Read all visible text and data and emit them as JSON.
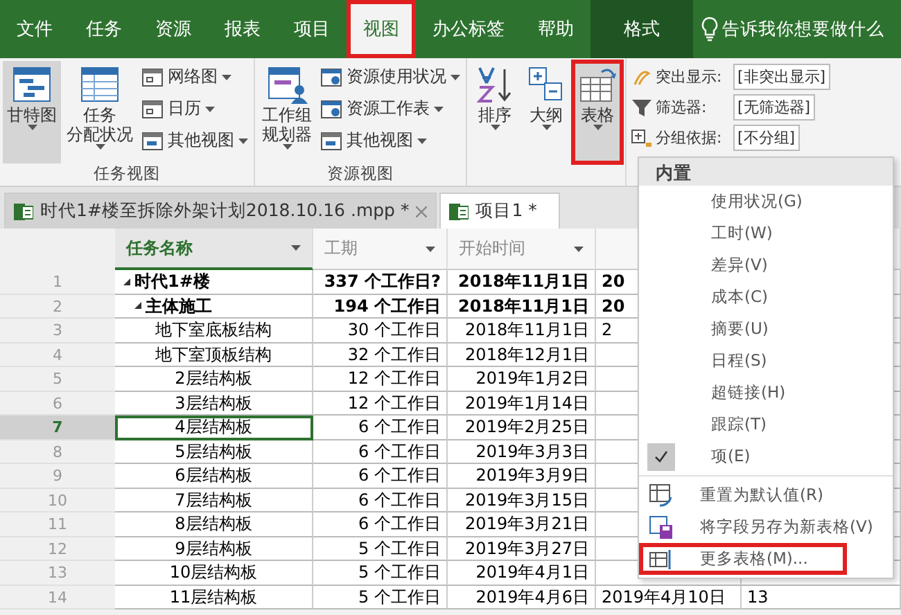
{
  "menu_tabs": [
    {
      "label": "文件",
      "selected": false,
      "highlighted": false
    },
    {
      "label": "任务",
      "selected": false,
      "highlighted": false
    },
    {
      "label": "资源",
      "selected": false,
      "highlighted": false
    },
    {
      "label": "报表",
      "selected": false,
      "highlighted": false
    },
    {
      "label": "项目",
      "selected": false,
      "highlighted": false
    },
    {
      "label": "视图",
      "selected": true,
      "highlighted": true
    },
    {
      "label": "办公标签",
      "selected": false,
      "highlighted": false
    },
    {
      "label": "帮助",
      "selected": false,
      "highlighted": false
    }
  ],
  "context_tab": {
    "label": "格式"
  },
  "tell_me": {
    "placeholder": "告诉我你想要做什么"
  },
  "ribbon": {
    "groups": [
      {
        "label": "任务视图",
        "large": [
          {
            "lines": [
              "甘特图"
            ],
            "selected": true
          },
          {
            "lines": [
              "任务",
              "分配状况"
            ],
            "selected": false
          }
        ],
        "small": [
          {
            "label": "网络图"
          },
          {
            "label": "日历"
          },
          {
            "label": "其他视图"
          }
        ]
      },
      {
        "label": "资源视图",
        "large": [
          {
            "lines": [
              "工作组",
              "规划器"
            ],
            "selected": false
          }
        ],
        "small": [
          {
            "label": "资源使用状况"
          },
          {
            "label": "资源工作表"
          },
          {
            "label": "其他视图"
          }
        ]
      },
      {
        "large": [
          {
            "lines": [
              "排序"
            ],
            "selected": false
          },
          {
            "lines": [
              "大纲"
            ],
            "selected": false
          },
          {
            "lines": [
              "表格"
            ],
            "selected": true,
            "highlighted": true
          }
        ]
      }
    ],
    "fields": [
      {
        "label": "突出显示:",
        "value": "[非突出显示]"
      },
      {
        "label": "筛选器:",
        "value": "[无筛选器]"
      },
      {
        "label": "分组依据:",
        "value": "[不分组]"
      }
    ]
  },
  "doc_tabs": [
    {
      "label": "时代1#楼至拆除外架计划2018.10.16 .mpp *",
      "selected": false,
      "closable": true
    },
    {
      "label": "项目1 *",
      "selected": true,
      "closable": false
    }
  ],
  "table": {
    "columns": [
      {
        "label": "任务名称",
        "sorted": true
      },
      {
        "label": "工期",
        "sorted": false
      },
      {
        "label": "开始时间",
        "sorted": false
      }
    ],
    "rows": [
      {
        "num": "1",
        "name": "时代1#楼",
        "duration": "337  个工作日?",
        "start": "2018年11月1日",
        "column_4": "20",
        "selected": false,
        "expanded": true,
        "children": [
          {
            "num": "2",
            "name": "主体施工",
            "duration": "194  个工作日",
            "start": "2018年11月1日",
            "column_4": "20",
            "selected": false,
            "expanded": true,
            "children": [
              {
                "num": "3",
                "name": "地下室底板结构",
                "duration": "30 个工作日",
                "start": "2018年11月1日",
                "column_4": "2",
                "selected": false
              },
              {
                "num": "4",
                "name": "地下室顶板结构",
                "duration": "32 个工作日",
                "start": "2018年12月1日",
                "selected": false
              },
              {
                "num": "5",
                "name": "2层结构板",
                "duration": "12 个工作日",
                "start": "2019年1月2日",
                "selected": false
              },
              {
                "num": "6",
                "name": "3层结构板",
                "duration": "12 个工作日",
                "start": "2019年1月14日",
                "selected": false
              },
              {
                "num": "7",
                "name": "4层结构板",
                "duration": "6 个工作日",
                "start": "2019年2月25日",
                "selected": true
              },
              {
                "num": "8",
                "name": "5层结构板",
                "duration": "6 个工作日",
                "start": "2019年3月3日",
                "selected": false
              },
              {
                "num": "9",
                "name": "6层结构板",
                "duration": "6 个工作日",
                "start": "2019年3月9日",
                "selected": false
              },
              {
                "num": "10",
                "name": "7层结构板",
                "duration": "6 个工作日",
                "start": "2019年3月15日",
                "selected": false
              },
              {
                "num": "11",
                "name": "8层结构板",
                "duration": "6 个工作日",
                "start": "2019年3月21日",
                "selected": false
              },
              {
                "num": "12",
                "name": "9层结构板",
                "duration": "5 个工作日",
                "start": "2019年3月27日",
                "selected": false
              },
              {
                "num": "13",
                "name": "10层结构板",
                "duration": "5 个工作日",
                "start": "2019年4月1日",
                "selected": false
              },
              {
                "num": "14",
                "name": "11层结构板",
                "duration": "5 个工作日",
                "start": "2019年4月6日",
                "column_4": "2019年4月10日",
                "column_5": "13",
                "selected": false
              }
            ]
          }
        ]
      }
    ]
  },
  "dropdown_menu": {
    "items": [
      {
        "kind": "header",
        "label": "内置"
      },
      {
        "kind": "item",
        "label": "使用状况(G)",
        "checked": false
      },
      {
        "kind": "item",
        "label": "工时(W)",
        "checked": false
      },
      {
        "kind": "item",
        "label": "差异(V)",
        "checked": false
      },
      {
        "kind": "item",
        "label": "成本(C)",
        "checked": false
      },
      {
        "kind": "item",
        "label": "摘要(U)",
        "checked": false
      },
      {
        "kind": "item",
        "label": "日程(S)",
        "checked": false
      },
      {
        "kind": "item",
        "label": "超链接(H)",
        "checked": false
      },
      {
        "kind": "item",
        "label": "跟踪(T)",
        "checked": false
      },
      {
        "kind": "item",
        "label": "项(E)",
        "checked": true
      },
      {
        "kind": "action",
        "label": "重置为默认值(R)",
        "highlighted": false
      },
      {
        "kind": "action",
        "label": "将字段另存为新表格(V)",
        "highlighted": false
      },
      {
        "kind": "action",
        "label": "更多表格(M)...",
        "highlighted": true
      }
    ]
  }
}
